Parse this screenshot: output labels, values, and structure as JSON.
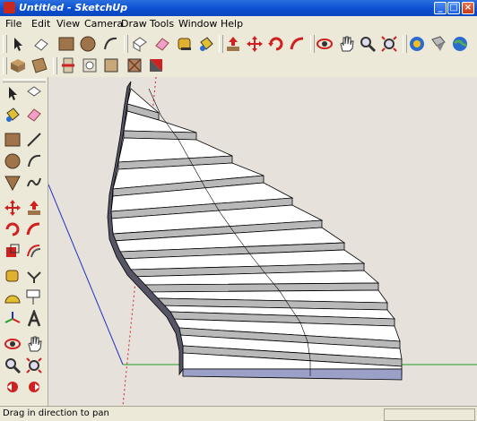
{
  "window": {
    "title": "Untitled - SketchUp"
  },
  "menu": [
    "File",
    "Edit",
    "View",
    "Camera",
    "Draw",
    "Tools",
    "Window",
    "Help"
  ],
  "status": {
    "text": "Drag in direction to pan"
  },
  "colors": {
    "titlebar": "#0b4fd1",
    "chrome": "#ece9d8",
    "viewport": "#e6e1db",
    "axis_red": "#d02020",
    "axis_green": "#20a020",
    "axis_blue": "#2030c0"
  },
  "toolbar1_icons": [
    "select-icon",
    "eraser-icon",
    "paint-bucket-icon",
    "rectangle-icon",
    "circle-icon",
    "arc-icon",
    "make-component-icon",
    "eraser-icon",
    "tape-measure-icon",
    "paint-bucket-icon",
    "push-pull-icon",
    "move-icon",
    "rotate-icon",
    "follow-me-icon",
    "orbit-icon",
    "pan-icon",
    "zoom-icon",
    "zoom-extents-icon",
    "get-models-icon",
    "share-model-icon",
    "google-earth-icon"
  ],
  "toolbar2_icons": [
    "iso-view-icon",
    "top-view-icon",
    "section-plane-icon",
    "x-ray-icon",
    "shaded-icon",
    "textured-icon",
    "monochrome-icon"
  ],
  "left_icons": [
    "select-icon",
    "make-component-icon",
    "paint-bucket-icon",
    "eraser-icon",
    "rectangle-icon",
    "line-icon",
    "circle-icon",
    "arc-icon",
    "polygon-icon",
    "freehand-icon",
    "move-icon",
    "push-pull-icon",
    "rotate-icon",
    "follow-me-icon",
    "scale-icon",
    "offset-icon",
    "tape-measure-icon",
    "dimension-icon",
    "protractor-icon",
    "text-icon",
    "axes-icon",
    "3d-text-icon",
    "orbit-icon",
    "pan-icon",
    "zoom-icon",
    "zoom-window-icon",
    "previous-view-icon",
    "next-view-icon"
  ]
}
